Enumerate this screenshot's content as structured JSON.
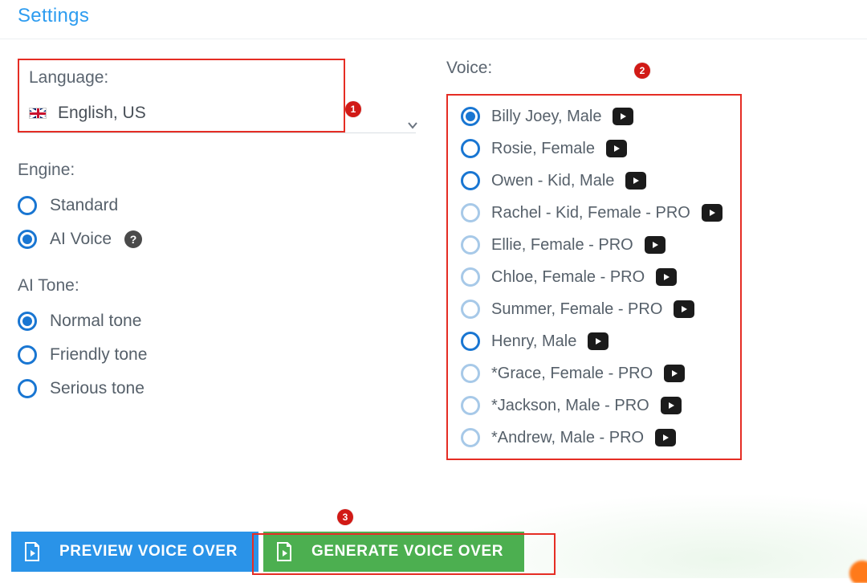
{
  "header": {
    "title": "Settings"
  },
  "language": {
    "label": "Language:",
    "selected": "English, US"
  },
  "engine": {
    "label": "Engine:",
    "options": [
      "Standard",
      "AI Voice"
    ],
    "selected": "AI Voice"
  },
  "ai_tone": {
    "label": "AI Tone:",
    "options": [
      "Normal tone",
      "Friendly tone",
      "Serious tone"
    ],
    "selected": "Normal tone"
  },
  "voice": {
    "label": "Voice:",
    "options": [
      {
        "label": "Billy Joey, Male",
        "selected": true,
        "faded": false
      },
      {
        "label": "Rosie, Female",
        "selected": false,
        "faded": false
      },
      {
        "label": "Owen - Kid, Male",
        "selected": false,
        "faded": false
      },
      {
        "label": "Rachel - Kid, Female - PRO",
        "selected": false,
        "faded": true
      },
      {
        "label": "Ellie, Female - PRO",
        "selected": false,
        "faded": true
      },
      {
        "label": "Chloe, Female - PRO",
        "selected": false,
        "faded": true
      },
      {
        "label": "Summer, Female - PRO",
        "selected": false,
        "faded": true
      },
      {
        "label": "Henry, Male",
        "selected": false,
        "faded": false
      },
      {
        "label": "*Grace, Female - PRO",
        "selected": false,
        "faded": true
      },
      {
        "label": "*Jackson, Male - PRO",
        "selected": false,
        "faded": true
      },
      {
        "label": "*Andrew, Male - PRO",
        "selected": false,
        "faded": true
      }
    ]
  },
  "buttons": {
    "preview": "PREVIEW VOICE OVER",
    "generate": "GENERATE VOICE OVER"
  },
  "callouts": {
    "c1": "1",
    "c2": "2",
    "c3": "3"
  },
  "icons": {
    "help": "?",
    "flag": "uk-flag",
    "chevron": "chevron-down",
    "play": "play",
    "doc_play": "file-play"
  }
}
